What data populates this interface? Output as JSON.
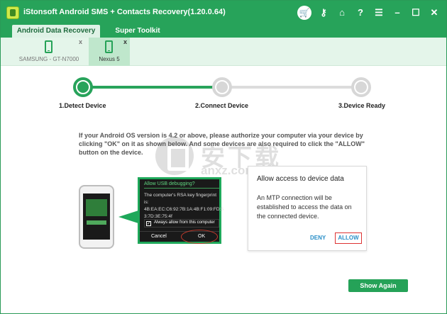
{
  "window": {
    "title": "iStonsoft Android SMS + Contacts Recovery(1.20.0.64)",
    "icons": [
      "cart-icon",
      "key-icon",
      "home-icon",
      "help-icon",
      "register-icon",
      "minimize-icon",
      "maximize-icon",
      "close-icon"
    ],
    "icon_glyphs": {
      "help": "?"
    }
  },
  "tabs": [
    {
      "label": "Android Data Recovery",
      "active": true
    },
    {
      "label": "Super Toolkit",
      "active": false
    }
  ],
  "devices": [
    {
      "label": "SAMSUNG - GT-N7000",
      "active": false,
      "close": "x"
    },
    {
      "label": "Nexus 5",
      "active": true,
      "close": "x"
    }
  ],
  "steps": [
    {
      "label": "1.Detect Device",
      "state": "done"
    },
    {
      "label": "2.Connect Device",
      "state": "pending"
    },
    {
      "label": "3.Device Ready",
      "state": "pending"
    }
  ],
  "progress": 0.5,
  "instructions": "If your Android OS version is 4.2 or above, please authorize your computer via your device by clicking \"OK\" on it as shown below. And some devices are also required to click the \"ALLOW\" button on the device.",
  "watermark": {
    "chars": "安下载",
    "url": "anxz.com"
  },
  "usb_dialog": {
    "title": "Allow USB debugging?",
    "text": "The computer's RSA key fingerprint is: 4B:EA:EC:C6:92:7B:1A:4B:F1:09:FD:5 3:7D:3E:75:4f",
    "checkbox_label": "Always allow from this computer",
    "checkbox_mark": "✓",
    "cancel": "Cancel",
    "ok": "OK"
  },
  "mtp_dialog": {
    "title": "Allow access to device data",
    "body": "An MTP connection will be established to access the data on the connected device.",
    "deny": "DENY",
    "allow": "ALLOW"
  },
  "show_again": "Show Again",
  "colors": {
    "accent": "#27a35a",
    "link": "#2a8fc8",
    "highlight": "#d33"
  }
}
